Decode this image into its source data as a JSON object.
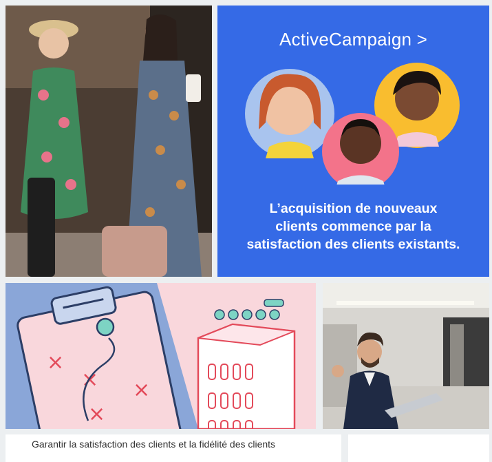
{
  "tiles": [
    {
      "type": "photo",
      "subject": "two women with suitcases in hotel lobby"
    },
    {
      "type": "ad",
      "brand": "ActiveCampaign >",
      "headline": "L’acquisition de nouveaux\nclients commence par la\nsatisfaction des clients existants.",
      "colors": {
        "background": "#356ae6",
        "circle_left": "#a9c4ee",
        "circle_right": "#f9bd2f",
        "circle_center": "#f3738a"
      }
    },
    {
      "type": "illustration",
      "subject": "strategy clipboard and building",
      "colors": {
        "background": "#f9d7dc",
        "panel": "#8aa6d8",
        "cross": "#e34a5a",
        "accent": "#7dd4c4"
      }
    },
    {
      "type": "photo",
      "subject": "businessman holding laptop giving ok sign"
    },
    {
      "type": "caption",
      "text": "Garantir la satisfaction des clients et la fidélité des clients"
    },
    {
      "type": "caption-partial",
      "text": ""
    }
  ]
}
